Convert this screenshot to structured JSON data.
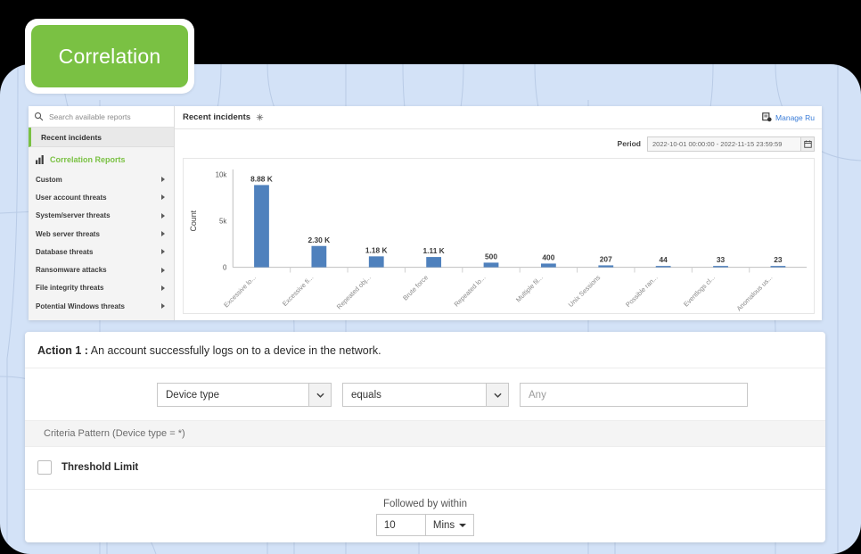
{
  "tab": {
    "label": "Correlation"
  },
  "sidebar": {
    "search_placeholder": "Search available reports",
    "recent_label": "Recent incidents",
    "section_title": "Correlation Reports",
    "items": [
      {
        "label": "Custom"
      },
      {
        "label": "User account threats"
      },
      {
        "label": "System/server threats"
      },
      {
        "label": "Web server threats"
      },
      {
        "label": "Database threats"
      },
      {
        "label": "Ransomware attacks"
      },
      {
        "label": "File integrity threats"
      },
      {
        "label": "Potential Windows threats"
      }
    ]
  },
  "chart_panel": {
    "title": "Recent incidents",
    "manage_link": "Manage Ru",
    "period_label": "Period",
    "period_value": "2022-10-01 00:00:00 - 2022-11-15 23:59:59"
  },
  "chart_data": {
    "type": "bar",
    "title": "Recent incidents",
    "xlabel": "",
    "ylabel": "Count",
    "ylim": [
      0,
      10000
    ],
    "yticks": [
      0,
      5000,
      10000
    ],
    "ytick_labels": [
      "0",
      "5k",
      "10k"
    ],
    "grid": false,
    "legend": "none",
    "bar_color": "#4F81BD",
    "categories": [
      "Excessive lo...",
      "Excessive fi...",
      "Repeated obj...",
      "Brute force",
      "Repeated lo...",
      "Multiple fil...",
      "Unix Sessions",
      "Possible ran...",
      "Eventlogs cl...",
      "Anomalous us..."
    ],
    "values": [
      8880,
      2300,
      1180,
      1110,
      500,
      400,
      207,
      44,
      33,
      23
    ],
    "data_labels": [
      "8.88 K",
      "2.30 K",
      "1.18 K",
      "1.11 K",
      "500",
      "400",
      "207",
      "44",
      "33",
      "23"
    ]
  },
  "action": {
    "heading_bold": "Action 1 :",
    "heading_text": " An account successfully logs on to a device in the network.",
    "field_value": "Device type",
    "operator_value": "equals",
    "value_placeholder": "Any",
    "criteria_pattern": "Criteria Pattern (Device type = *)",
    "threshold_label": "Threshold Limit",
    "followed_label": "Followed by within",
    "followed_value": "10",
    "followed_unit": "Mins"
  }
}
